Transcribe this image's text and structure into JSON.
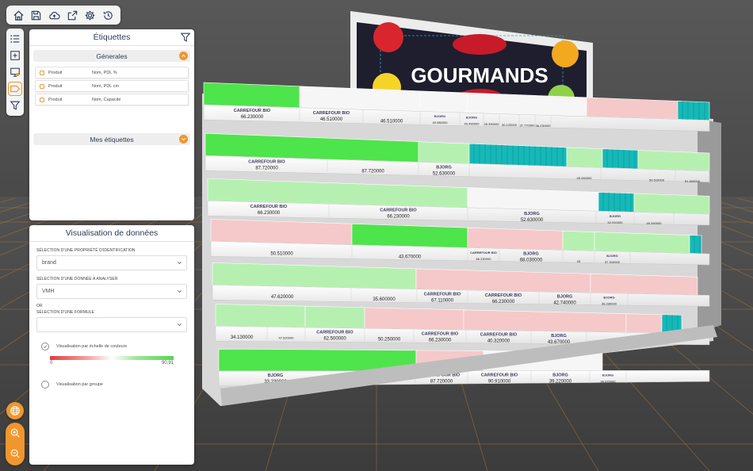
{
  "toolbar": {
    "buttons": [
      {
        "name": "home-icon"
      },
      {
        "name": "save-icon"
      },
      {
        "name": "cloud-upload-icon"
      },
      {
        "name": "export-icon"
      },
      {
        "name": "gear-icon"
      },
      {
        "name": "history-icon"
      }
    ]
  },
  "side_toolbar": {
    "buttons": [
      {
        "name": "list-icon"
      },
      {
        "name": "add-icon"
      },
      {
        "name": "presentation-icon"
      },
      {
        "name": "label-icon",
        "active": true
      },
      {
        "name": "filter-icon"
      }
    ]
  },
  "labels_panel": {
    "title": "Étiquettes",
    "general_section": "Génerales",
    "rows": [
      {
        "type": "Produit",
        "field": "Nom, PDL %"
      },
      {
        "type": "Produit",
        "field": "Nom, PDL cm"
      },
      {
        "type": "Produit",
        "field": "Nom, Capacité"
      }
    ],
    "my_labels_section": "Mes étiquettes"
  },
  "viz_panel": {
    "title": "Visualisation de données",
    "id_property_label": "SÉLECTION D'UNE PROPRIÉTÉ D'IDENTIFICATION",
    "id_property_value": "brand",
    "data_label": "SÉLECTION D'UNE DONNÉE A ANALYSER",
    "data_value": "VMH",
    "or_label": "OR",
    "formula_label": "SÉLECTION D'UNE FORMULE",
    "formula_value": "",
    "color_scale_option": "Visualisation par échelle de couleurs",
    "scale_min": "0",
    "scale_max": "90,91",
    "group_option": "Visualisation par groupe",
    "selected_option": "color_scale"
  },
  "scene": {
    "header_sign": "GOURMANDS",
    "tags": [
      {
        "brand": "CARREFOUR BIO",
        "value": "66.230000"
      },
      {
        "brand": "CARREFOUR BIO",
        "value": "46.510000"
      },
      {
        "brand": "",
        "value": "46.510000"
      },
      {
        "brand": "BJORG",
        "value": "40.980000"
      },
      {
        "brand": "BJORG",
        "value": "40.490000"
      },
      {
        "brand": "",
        "value": "25.390000"
      },
      {
        "brand": "",
        "value": "30.120000"
      },
      {
        "brand": "",
        "value": "37.770000"
      },
      {
        "brand": "",
        "value": "36.230000"
      },
      {
        "brand": "CARREFOUR BIO",
        "value": "87.720000"
      },
      {
        "brand": "",
        "value": "87.720000"
      },
      {
        "brand": "BJORG",
        "value": "52.630000"
      },
      {
        "brand": "",
        "value": "49.260000"
      },
      {
        "brand": "",
        "value": "50.510000"
      },
      {
        "brand": "",
        "value": "51.600000"
      },
      {
        "brand": "CARREFOUR BIO",
        "value": "66.230000"
      },
      {
        "brand": "CARREFOUR BIO",
        "value": "66.230000"
      },
      {
        "brand": "BJORG",
        "value": "52.630000"
      },
      {
        "brand": "BJORG",
        "value": "52.910000"
      },
      {
        "brand": "",
        "value": "49.260000"
      },
      {
        "brand": "",
        "value": "50.510000"
      },
      {
        "brand": "",
        "value": "43.670000"
      },
      {
        "brand": "CARREFOUR BIO",
        "value": "66.230000"
      },
      {
        "brand": "BJORG",
        "value": "68.030000"
      },
      {
        "brand": "",
        "value": "43"
      },
      {
        "brand": "BJORG",
        "value": "37.310000"
      },
      {
        "brand": "",
        "value": "47.620000"
      },
      {
        "brand": "",
        "value": "35.600000"
      },
      {
        "brand": "CARREFOUR BIO",
        "value": "67.110000"
      },
      {
        "brand": "CARREFOUR BIO",
        "value": "66.230000"
      },
      {
        "brand": "BJORG",
        "value": "42.740000"
      },
      {
        "brand": "BJORG",
        "value": "36.230000"
      },
      {
        "brand": "",
        "value": "34.130000"
      },
      {
        "brand": "",
        "value": "47.620000"
      },
      {
        "brand": "CARREFOUR BIO",
        "value": "62.500000"
      },
      {
        "brand": "",
        "value": "50.250000"
      },
      {
        "brand": "CARREFOUR BIO",
        "value": "66.230000"
      },
      {
        "brand": "CARREFOUR BIO",
        "value": "40.320000"
      },
      {
        "brand": "BJORG",
        "value": "43.670000"
      },
      {
        "brand": "BJORG",
        "value": "33.230000"
      },
      {
        "brand": "",
        "value": "34.160000"
      },
      {
        "brand": "CARREFOUR BIO",
        "value": "87.720000"
      },
      {
        "brand": "CARREFOUR BIO",
        "value": "90.910000"
      },
      {
        "brand": "BJORG",
        "value": "39.220000"
      },
      {
        "brand": "BJORG",
        "value": "34.970000"
      },
      {
        "brand": "",
        "value": "34.130000"
      },
      {
        "brand": "",
        "value": "48.650000"
      }
    ],
    "colors": {
      "high": "#4ee44b",
      "mid_green": "#b6f0b1",
      "neutral": "#f6f6f6",
      "low": "#f5c9c9",
      "teal": "#16b8b8",
      "accent": "#f0962e",
      "sign_bg": "#1e1e2e"
    }
  }
}
